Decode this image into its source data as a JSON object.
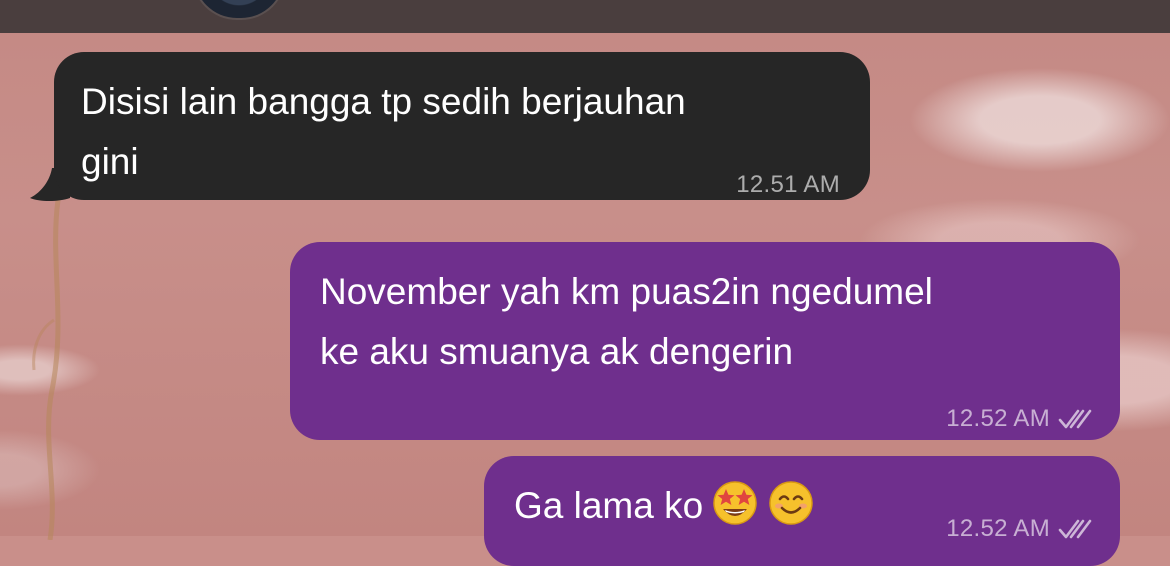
{
  "chat": {
    "messages": [
      {
        "direction": "incoming",
        "text": "Disisi lain bangga tp sedih berjauhan\ngini",
        "time": "12.51 AM"
      },
      {
        "direction": "outgoing",
        "text": "November yah km puas2in ngedumel\nke aku smuanya ak dengerin",
        "time": "12.52 AM",
        "status_icon": "double-check-icon"
      },
      {
        "direction": "outgoing",
        "text": "Ga lama ko",
        "emojis": [
          "star-struck-emoji",
          "smiling-face-emoji"
        ],
        "time": "12.52 AM",
        "status_icon": "double-check-icon"
      }
    ]
  },
  "colors": {
    "incoming_bubble": "#262626",
    "outgoing_bubble": "#6f2f8d",
    "top_bar": "#4a3e3e",
    "wallpaper": "#c98f8a"
  }
}
